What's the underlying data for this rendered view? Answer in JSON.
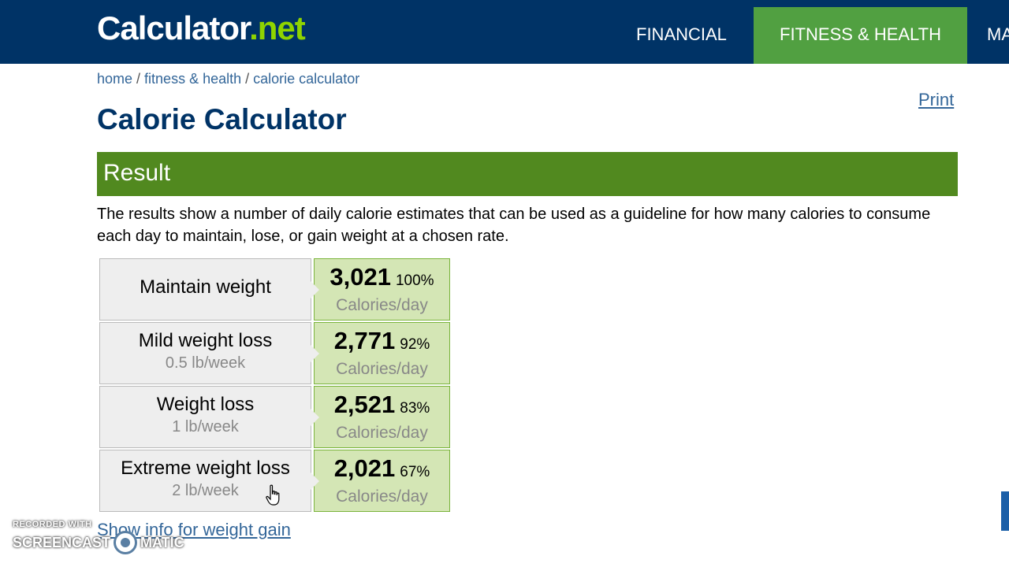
{
  "header": {
    "logo_main": "Calculator",
    "logo_dot": ".",
    "logo_tld": "net",
    "nav": [
      {
        "label": "FINANCIAL"
      },
      {
        "label": "FITNESS & HEALTH"
      },
      {
        "label": "MA"
      }
    ],
    "colors": {
      "header_bg": "#003366",
      "active_nav_bg": "#51a041",
      "logo_accent": "#8fd400"
    }
  },
  "breadcrumb": {
    "home": "home",
    "sep": " / ",
    "section": "fitness & health",
    "current": "calorie calculator"
  },
  "print_label": "Print",
  "page_title": "Calorie Calculator",
  "result": {
    "title": "Result",
    "description": "The results show a number of daily calorie estimates that can be used as a guideline for how many calories to consume each day to maintain, lose, or gain weight at a chosen rate.",
    "rows": [
      {
        "label": "Maintain weight",
        "sub": "",
        "calories": "3,021",
        "percent": "100%",
        "unit": "Calories/day"
      },
      {
        "label": "Mild weight loss",
        "sub": "0.5 lb/week",
        "calories": "2,771",
        "percent": "92%",
        "unit": "Calories/day"
      },
      {
        "label": "Weight loss",
        "sub": "1 lb/week",
        "calories": "2,521",
        "percent": "83%",
        "unit": "Calories/day"
      },
      {
        "label": "Extreme weight loss",
        "sub": "2 lb/week",
        "calories": "2,021",
        "percent": "67%",
        "unit": "Calories/day"
      }
    ],
    "colors": {
      "result_bar": "#51891f",
      "value_bg": "#d4e6b5",
      "label_bg": "#eeeeee"
    }
  },
  "gain_link": "Show info for weight gain",
  "watermark": {
    "top": "RECORDED WITH",
    "left": "SCREENCAST",
    "right": "MATIC"
  },
  "cursor_icon": "hand-pointer-icon"
}
